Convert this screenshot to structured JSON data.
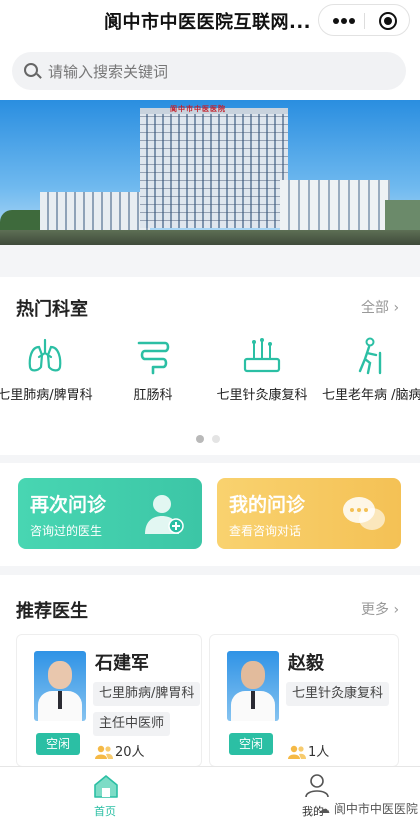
{
  "header": {
    "title": "阆中市中医医院互联网..."
  },
  "capsule": {
    "more_icon": "more-dots-icon",
    "close_icon": "target-circle-icon"
  },
  "search": {
    "placeholder": "请输入搜索关键词",
    "icon": "search-icon"
  },
  "banner": {
    "sign_text": "阆中市中医医院"
  },
  "departments": {
    "title": "热门科室",
    "more_label": "全部",
    "items": [
      {
        "label": "七里肺病/脾胃科",
        "icon": "lungs-icon"
      },
      {
        "label": "肛肠科",
        "icon": "intestine-icon"
      },
      {
        "label": "七里针灸康复科",
        "icon": "acupuncture-icon"
      },
      {
        "label": "七里老年病 /脑病科",
        "icon": "elderly-walker-icon"
      }
    ],
    "page_indicator": {
      "pages": 2,
      "active": 0
    }
  },
  "quick_actions": [
    {
      "title": "再次问诊",
      "subtitle": "咨询过的医生",
      "icon": "doctor-add-icon",
      "color": "#3ecfae"
    },
    {
      "title": "我的问诊",
      "subtitle": "查看咨询对话",
      "icon": "chat-bubbles-icon",
      "color": "#f6c85c"
    }
  ],
  "doctors": {
    "title": "推荐医生",
    "more_label": "更多",
    "items": [
      {
        "name": "石建军",
        "department": "七里肺病/脾胃科",
        "title": "主任中医师",
        "status": "空闲",
        "count": "20人"
      },
      {
        "name": "赵毅",
        "department": "七里针灸康复科",
        "title": "",
        "status": "空闲",
        "count": "1人"
      }
    ]
  },
  "tabbar": {
    "items": [
      {
        "label": "首页",
        "icon": "home-icon",
        "active": true
      },
      {
        "label": "我的",
        "icon": "user-icon",
        "active": false
      }
    ],
    "active_color": "#2bbfa4"
  },
  "watermark": "阆中市中医医院"
}
